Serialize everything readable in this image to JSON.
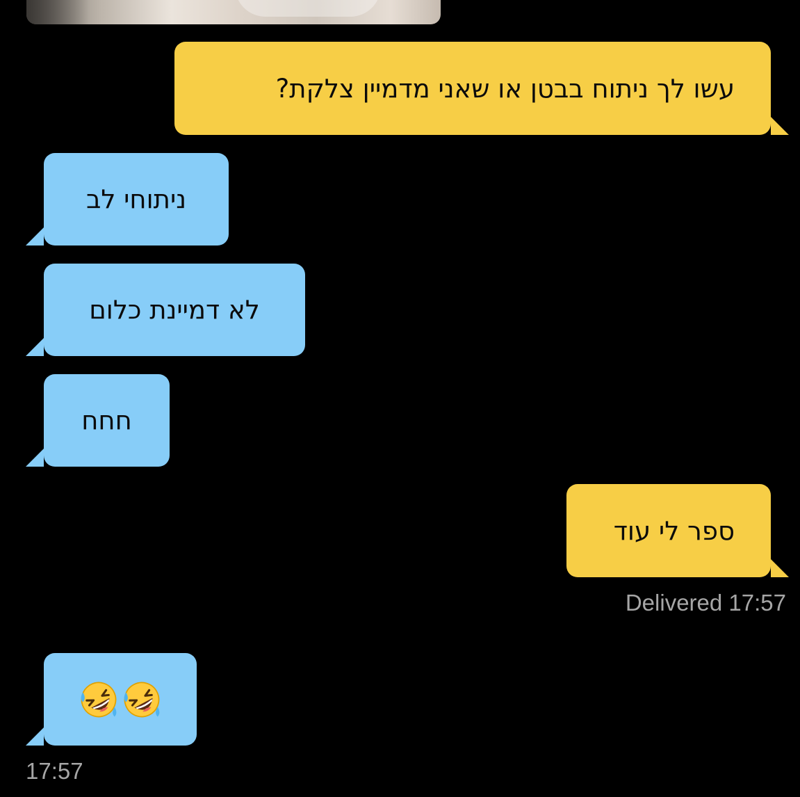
{
  "messages": [
    {
      "direction": "out",
      "text": "עשו לך ניתוח בבטן או שאני מדמיין צלקת?"
    },
    {
      "direction": "in",
      "text": "ניתוחי לב"
    },
    {
      "direction": "in",
      "text": "לא דמיינת כלום"
    },
    {
      "direction": "in",
      "text": "חחח"
    },
    {
      "direction": "out",
      "text": "ספר לי עוד"
    },
    {
      "direction": "in",
      "emoji": [
        "rolling-on-floor-laughing",
        "rolling-on-floor-laughing"
      ]
    }
  ],
  "status": {
    "delivered": "Delivered 17:57",
    "last_time": "17:57"
  },
  "colors": {
    "background": "#000000",
    "outgoing_bubble": "#f7ce46",
    "incoming_bubble": "#87cdf8",
    "meta_text": "#a6a6a6"
  }
}
